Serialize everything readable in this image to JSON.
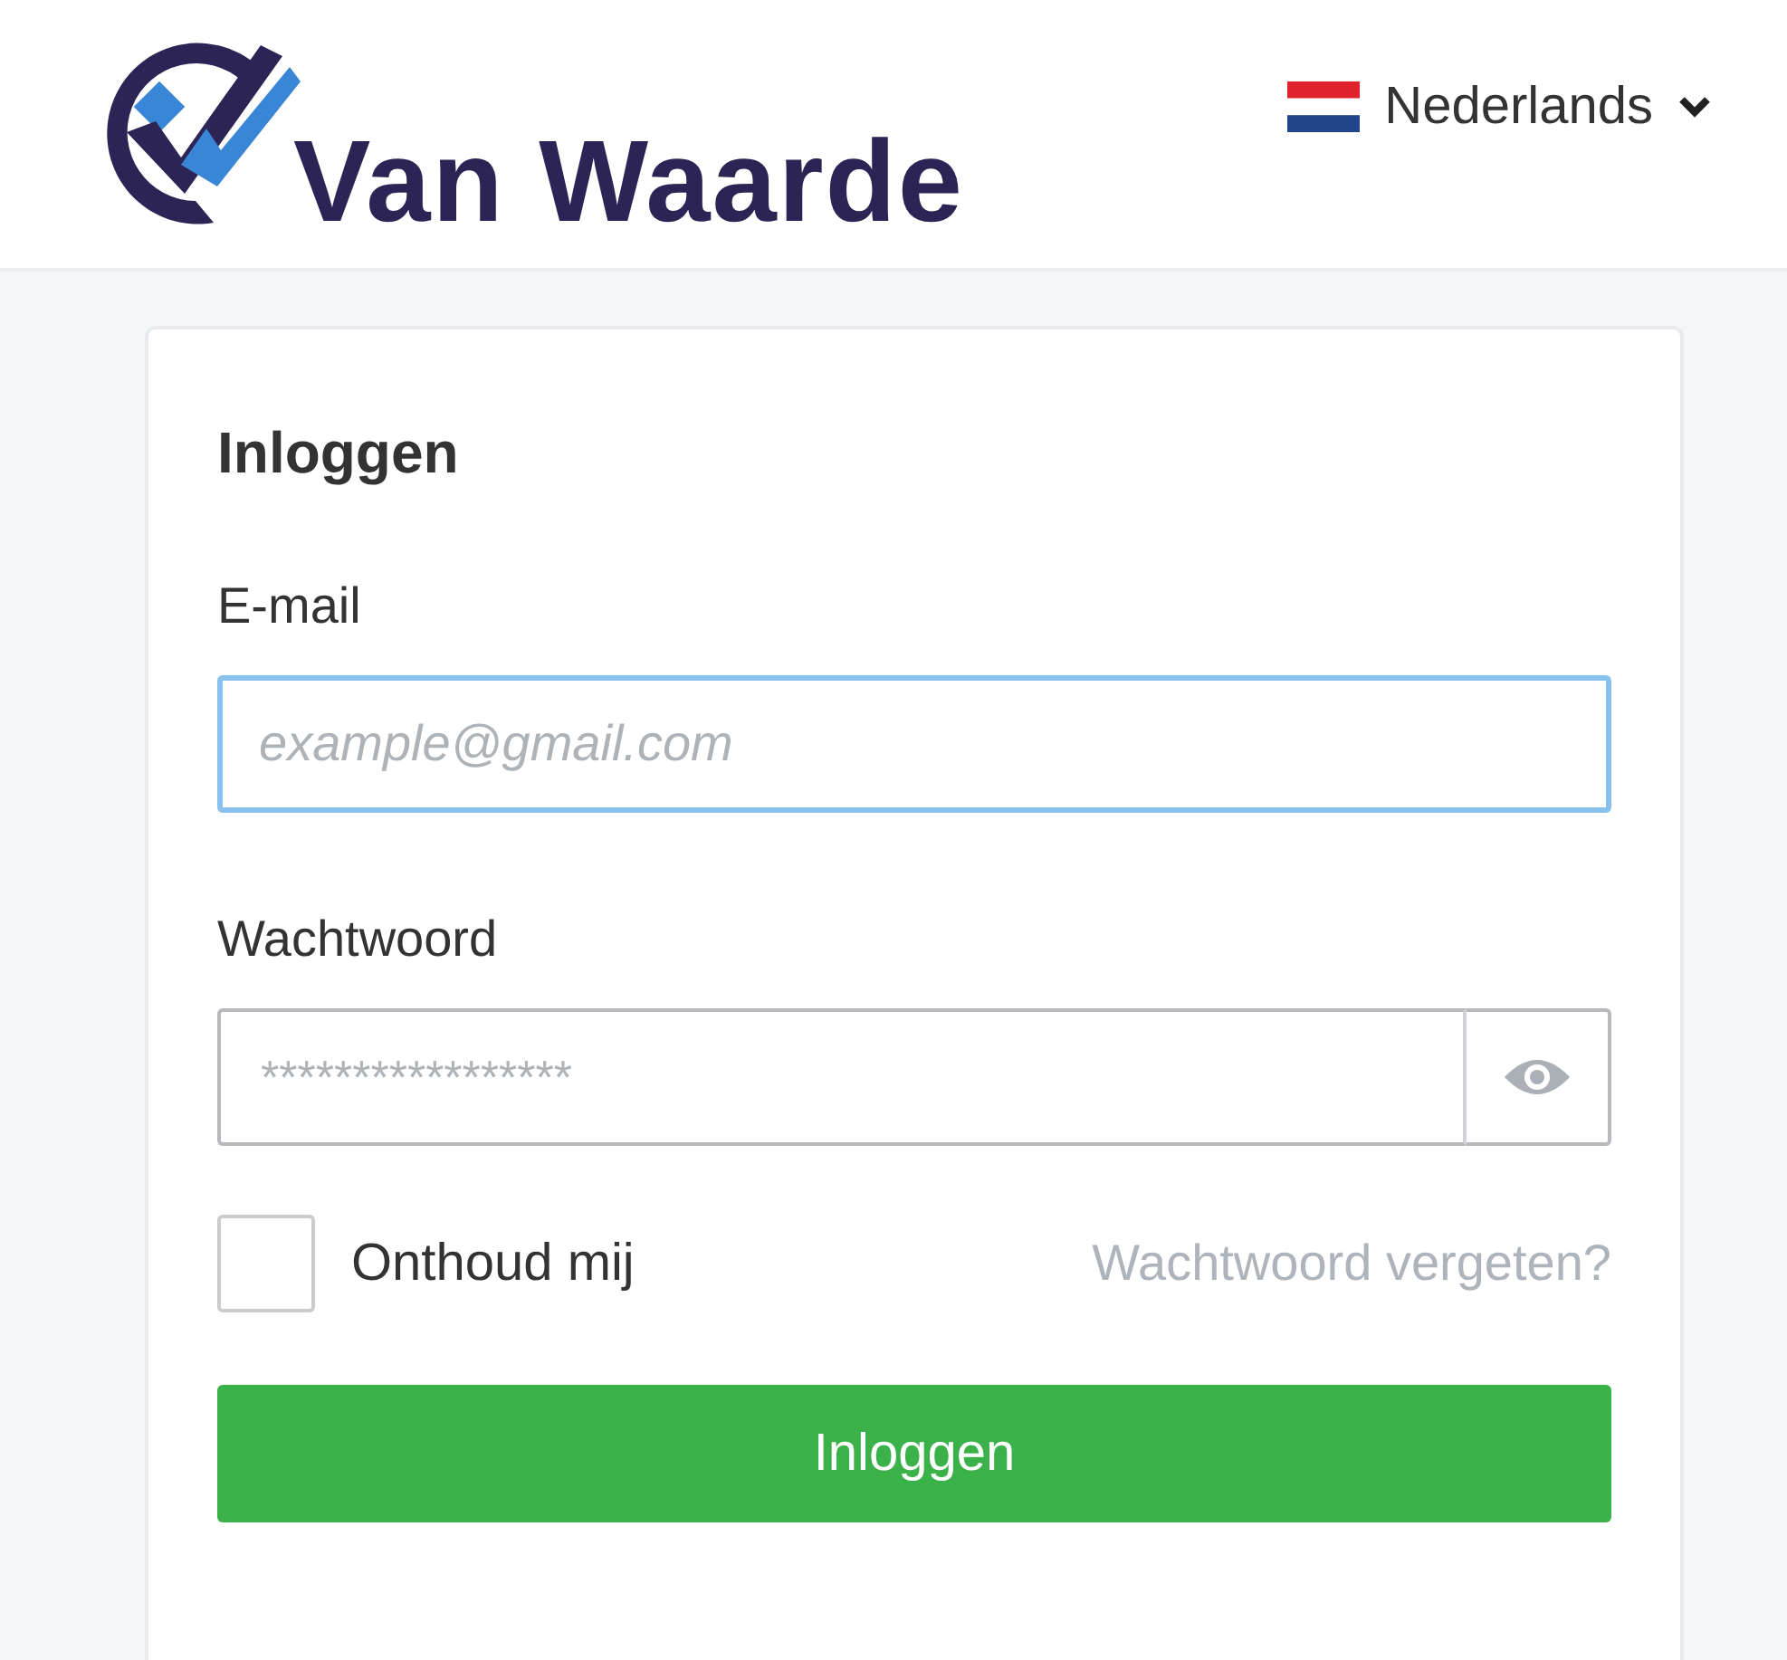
{
  "header": {
    "logo_text": "Van Waarde",
    "language": {
      "label": "Nederlands"
    }
  },
  "login": {
    "title": "Inloggen",
    "fields": [
      {
        "kind": "email",
        "label": "E-mail",
        "placeholder": "example@gmail.com",
        "focused": true
      },
      {
        "kind": "password",
        "label": "Wachtwoord",
        "placeholder": "*****************",
        "focused": false
      }
    ],
    "remember": {
      "label": "Onthoud mij",
      "checked": false
    },
    "forgot_link": "Wachtwoord vergeten?",
    "submit": "Inloggen"
  }
}
